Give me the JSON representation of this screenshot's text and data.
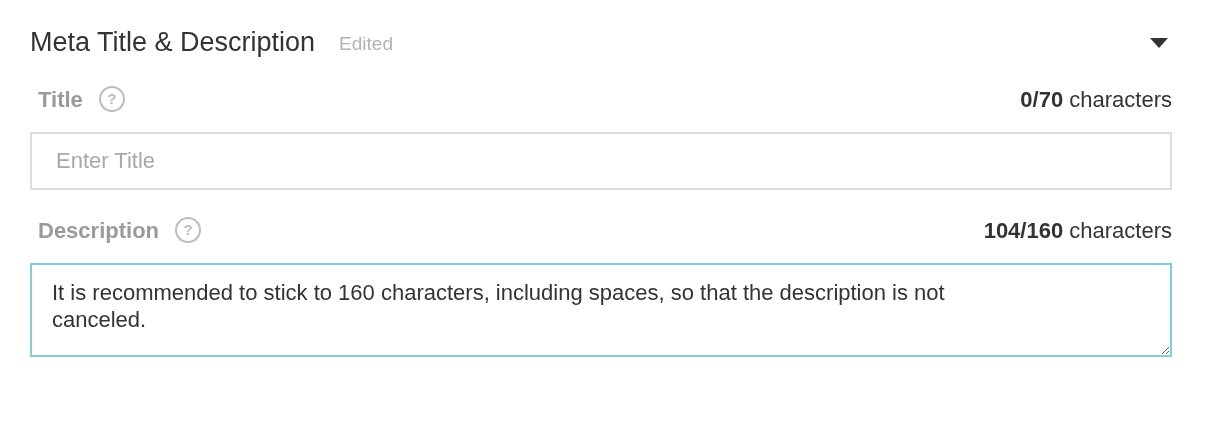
{
  "section": {
    "title": "Meta Title & Description",
    "status": "Edited",
    "expanded": true
  },
  "fields": [
    {
      "kind": "input",
      "label": "Title",
      "help": "?",
      "counter": "**0/70** characters",
      "placeholder": "Enter Title",
      "focused": false
    },
    {
      "kind": "textarea",
      "label": "Description",
      "help": "?",
      "counter": "**104/160** characters",
      "value": "It is recommended to stick to 160 characters, including spaces, so that the description is not canceled.",
      "focused": true
    }
  ]
}
